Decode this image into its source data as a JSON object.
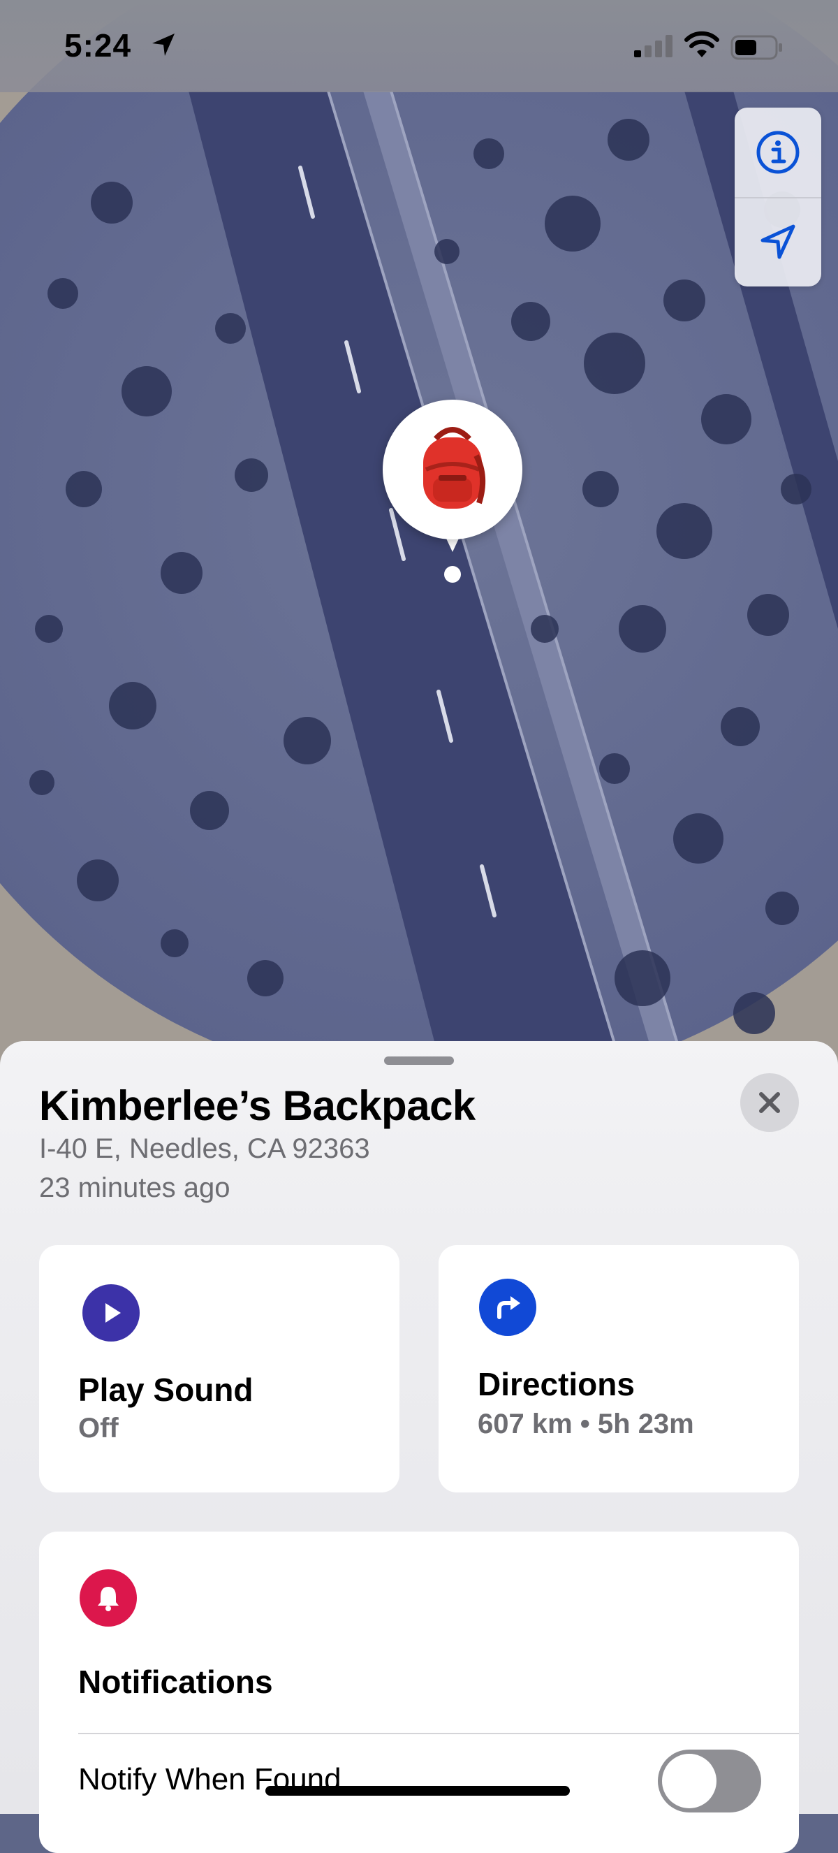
{
  "status_bar": {
    "time": "5:24",
    "location_icon": "location-arrow-icon",
    "signal_icon": "cellular-signal-icon",
    "wifi_icon": "wifi-icon",
    "battery_icon": "battery-icon"
  },
  "map": {
    "type": "satellite",
    "controls": [
      {
        "name": "info",
        "icon": "info-icon"
      },
      {
        "name": "location",
        "icon": "location-arrow-icon"
      }
    ],
    "pin": {
      "icon": "backpack-emoji",
      "glyph": "🎒"
    },
    "accent_color": "#0a52d6"
  },
  "item": {
    "title": "Kimberlee’s Backpack",
    "address": "I-40 E, Needles, CA  92363",
    "last_seen": "23 minutes ago",
    "close_icon": "close-icon"
  },
  "actions": {
    "play_sound": {
      "title": "Play Sound",
      "status": "Off",
      "icon": "play-icon",
      "color": "#3c32a8"
    },
    "directions": {
      "title": "Directions",
      "detail": "607 km • 5h 23m",
      "icon": "turn-right-arrow-icon",
      "color": "#1149d6"
    }
  },
  "notifications": {
    "title": "Notifications",
    "icon": "bell-icon",
    "color": "#dc174c",
    "notify_when_found": {
      "label": "Notify When Found",
      "enabled": false
    }
  }
}
